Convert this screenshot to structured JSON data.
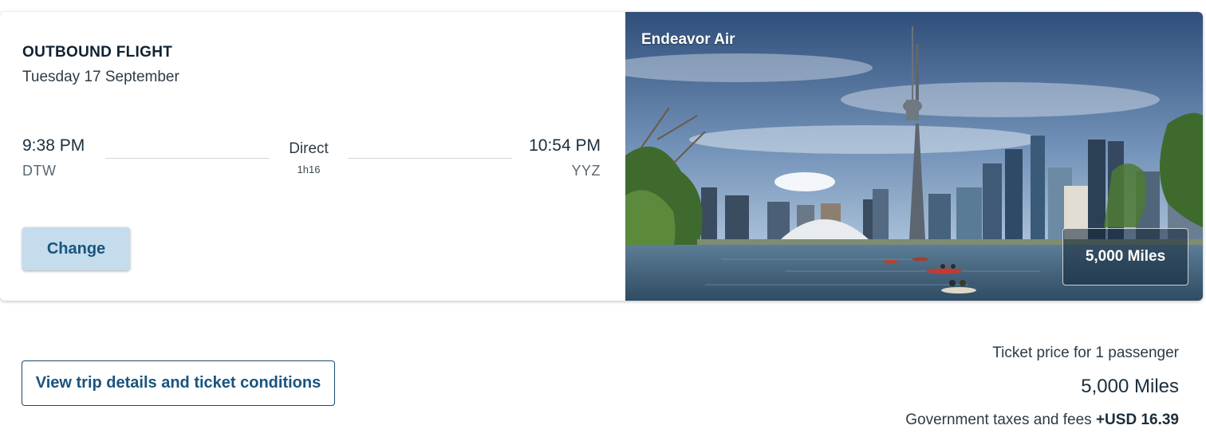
{
  "flight": {
    "title": "OUTBOUND FLIGHT",
    "date": "Tuesday 17 September",
    "departure": {
      "time": "9:38 PM",
      "airport": "DTW"
    },
    "arrival": {
      "time": "10:54 PM",
      "airport": "YYZ"
    },
    "stops": "Direct",
    "duration": "1h16",
    "change_label": "Change"
  },
  "destination_photo": {
    "airline": "Endeavor Air",
    "miles_badge": "5,000 Miles",
    "scene": "toronto-skyline-photo"
  },
  "trip": {
    "details_label": "View trip details and ticket conditions"
  },
  "pricing": {
    "ticket_label": "Ticket price for 1 passenger",
    "miles": "5,000 Miles",
    "tax_label": "Government taxes and fees",
    "tax_amount": "+USD 16.39"
  },
  "colors": {
    "accent": "#18547d",
    "button_bg": "#c5dced",
    "text": "#1b2e3c"
  }
}
